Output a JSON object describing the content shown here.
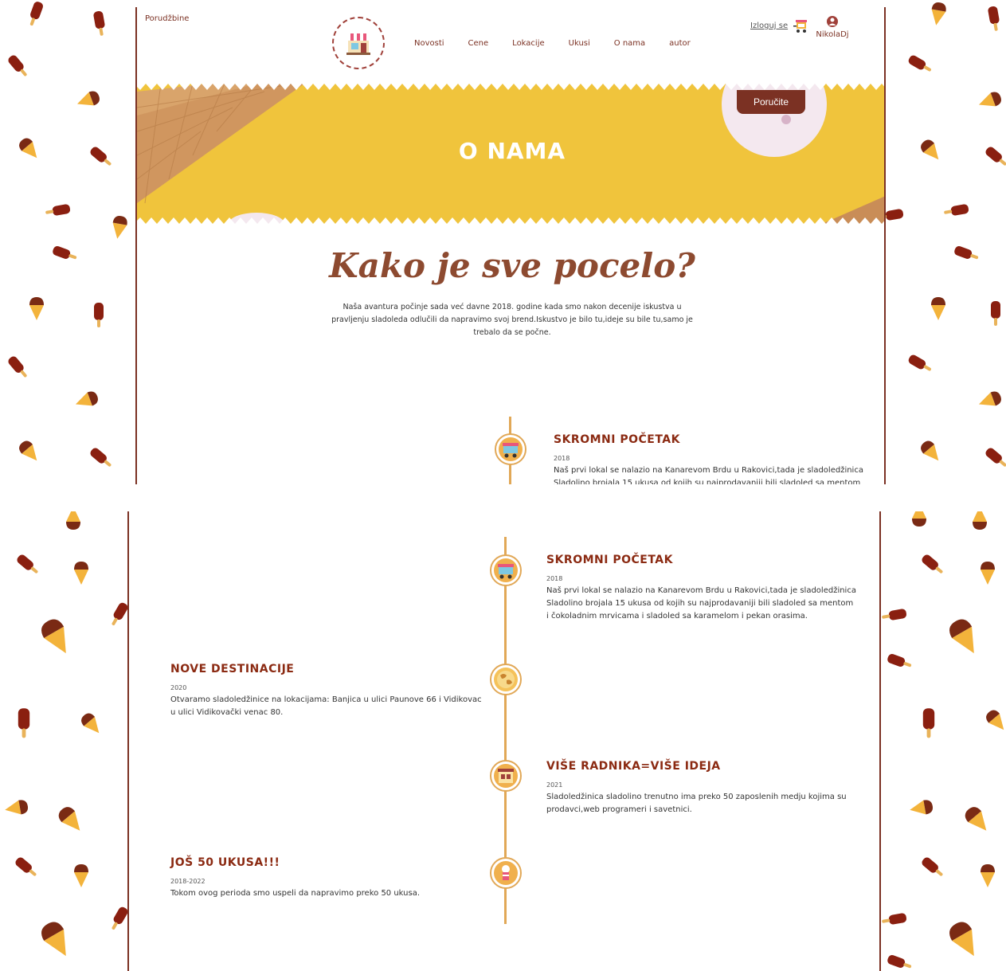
{
  "header": {
    "orders_link": "Porudžbine",
    "logout_label": "Izloguj se",
    "username": "NikolaDj",
    "nav": [
      {
        "label": "Novosti"
      },
      {
        "label": "Cene"
      },
      {
        "label": "Lokacije"
      },
      {
        "label": "Ukusi"
      },
      {
        "label": "O nama"
      },
      {
        "label": "autor"
      }
    ],
    "logo_icon": "shop-icon",
    "cart_icon": "ice-cream-cart-icon",
    "user_icon": "user-icon"
  },
  "banner": {
    "title": "O NAMA",
    "order_button": "Poručite"
  },
  "intro": {
    "title": "Kako je sve pocelo?",
    "text": "Naša avantura počinje sada već davne 2018. godine kada smo nakon decenije iskustva u pravljenju sladoleda odlučili da napravimo svoj brend.Iskustvo je bilo tu,ideje su bile tu,samo je trebalo da se počne."
  },
  "timeline_top": {
    "title": "SKROMNI POČETAK",
    "year": "2018",
    "text": "Naš prvi lokal se nalazio na Kanarevom Brdu u Rakovici,tada je sladoledžinica Sladolino brojala 15 ukusa od kojih su najprodavaniji bili sladoled sa mentom"
  },
  "timeline": [
    {
      "title": "SKROMNI POČETAK",
      "year": "2018",
      "line1": "Naš prvi lokal se nalazio na Kanarevom Brdu u Rakovici,tada je sladoledžinica",
      "line2": "Sladolino brojala 15 ukusa od kojih su najprodavaniji bili sladoled sa mentom",
      "line3": "i čokoladnim mrvicama i sladoled sa karamelom i pekan orasima.",
      "icon": "shop-cart-icon"
    },
    {
      "title": "NOVE DESTINACIJE",
      "year": "2020",
      "line1": "Otvaramo sladoledžinice na lokacijama: Banjica u ulici Paunove 66 i Vidikovac",
      "line2": "u ulici Vidikovački venac 80.",
      "icon": "map-icon"
    },
    {
      "title": "VIŠE RADNIKA=VIŠE IDEJA",
      "year": "2021",
      "line1": "Sladoledžinica sladolino trenutno ima preko 50 zaposlenih medju kojima su",
      "line2": "prodavci,web programeri i savetnici.",
      "icon": "store-icon"
    },
    {
      "title": "JOŠ 50 UKUSA!!!",
      "year": "2018-2022",
      "line1": "Tokom ovog perioda smo uspeli da napravimo preko 50 ukusa.",
      "icon": "ice-cream-icon"
    }
  ],
  "colors": {
    "brand_brown": "#7b3123",
    "heading_red": "#8b2a12",
    "banner_yellow": "#f0c43c",
    "timeline_gold": "#e1a857"
  }
}
